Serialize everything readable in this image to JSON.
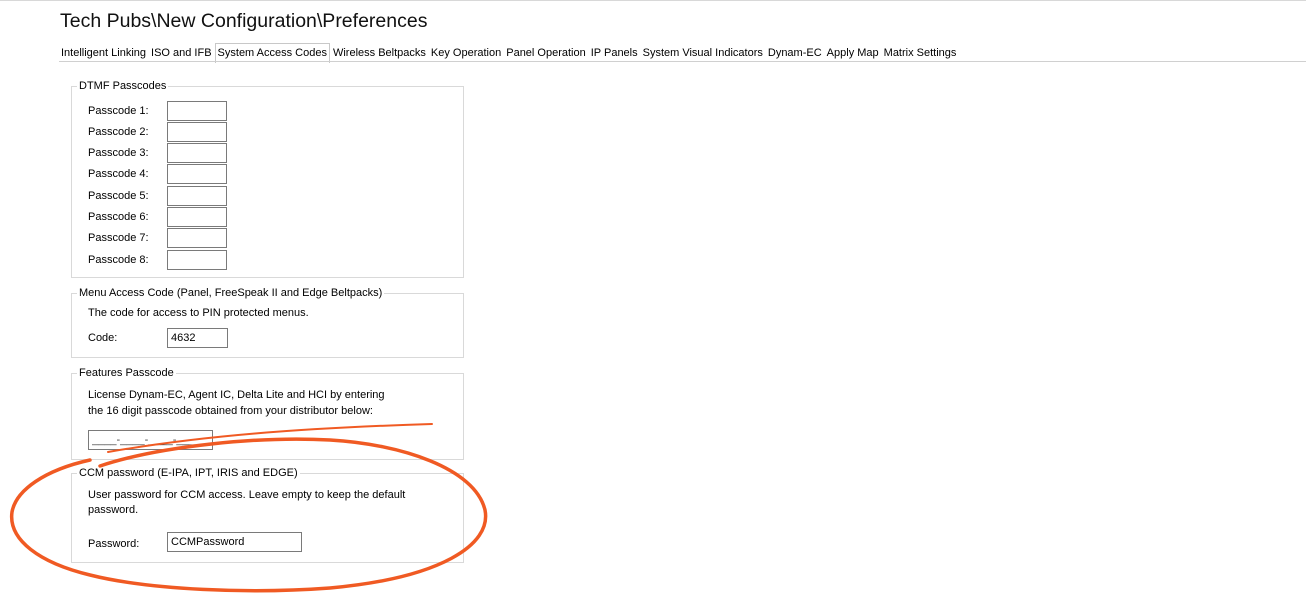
{
  "window": {
    "title": "Tech Pubs\\New Configuration\\Preferences"
  },
  "tabs": [
    {
      "label": "Intelligent Linking",
      "active": false
    },
    {
      "label": "ISO and IFB",
      "active": false
    },
    {
      "label": "System Access Codes",
      "active": true
    },
    {
      "label": "Wireless Beltpacks",
      "active": false
    },
    {
      "label": "Key Operation",
      "active": false
    },
    {
      "label": "Panel Operation",
      "active": false
    },
    {
      "label": "IP Panels",
      "active": false
    },
    {
      "label": "System Visual Indicators",
      "active": false
    },
    {
      "label": "Dynam-EC",
      "active": false
    },
    {
      "label": "Apply Map",
      "active": false
    },
    {
      "label": "Matrix Settings",
      "active": false
    }
  ],
  "dtmf": {
    "legend": "DTMF Passcodes",
    "passcodes": [
      {
        "label": "Passcode 1:",
        "value": ""
      },
      {
        "label": "Passcode 2:",
        "value": ""
      },
      {
        "label": "Passcode 3:",
        "value": ""
      },
      {
        "label": "Passcode 4:",
        "value": ""
      },
      {
        "label": "Passcode 5:",
        "value": ""
      },
      {
        "label": "Passcode 6:",
        "value": ""
      },
      {
        "label": "Passcode 7:",
        "value": ""
      },
      {
        "label": "Passcode 8:",
        "value": ""
      }
    ]
  },
  "menu_access": {
    "legend": "Menu Access Code (Panel, FreeSpeak II and Edge Beltpacks)",
    "description": "The code for access to PIN protected menus.",
    "code_label": "Code:",
    "code_value": "4632"
  },
  "features": {
    "legend": "Features Passcode",
    "description_line1": "License Dynam-EC, Agent IC, Delta Lite and HCI by entering",
    "description_line2": "the 16 digit passcode obtained from your distributor below:",
    "passcode_mask": "____-____-____-____"
  },
  "ccm": {
    "legend": "CCM password (E-IPA, IPT, IRIS and EDGE)",
    "description_line1": "User password for CCM access. Leave empty to keep the default",
    "description_line2": "password.",
    "password_label": "Password:",
    "password_value": "CCMPassword"
  },
  "annotation": {
    "color": "#f05a23"
  }
}
